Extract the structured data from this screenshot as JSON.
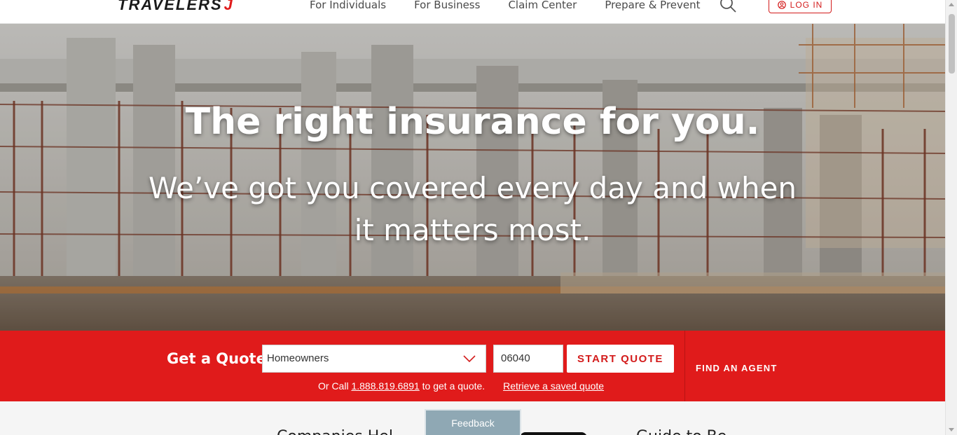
{
  "header": {
    "logo_text": "TRAVELERS",
    "logo_mark": "J",
    "nav": [
      "For Individuals",
      "For Business",
      "Claim Center",
      "Prepare & Prevent"
    ],
    "search_icon": "search-icon",
    "login_label": "LOG IN",
    "login_icon": "user-circle-icon"
  },
  "hero": {
    "title": "The right insurance for you.",
    "subtitle": "We’ve got you covered every day and when it matters most."
  },
  "quote": {
    "label": "Get a Quote",
    "product_value": "Homeowners",
    "zip_value": "06040",
    "start_label": "START QUOTE",
    "call_prefix": "Or Call",
    "phone": "1.888.819.6891",
    "call_suffix": "to get a quote.",
    "retrieve_label": "Retrieve a saved quote",
    "find_agent_label": "FIND AN AGENT"
  },
  "below": {
    "left_fragment": "Companies Hel",
    "right_fragment": "Guide to Be"
  },
  "feedback_label": "Feedback",
  "colors": {
    "brand_red": "#e01b1b",
    "feedback_bg": "#8fa8b4"
  }
}
